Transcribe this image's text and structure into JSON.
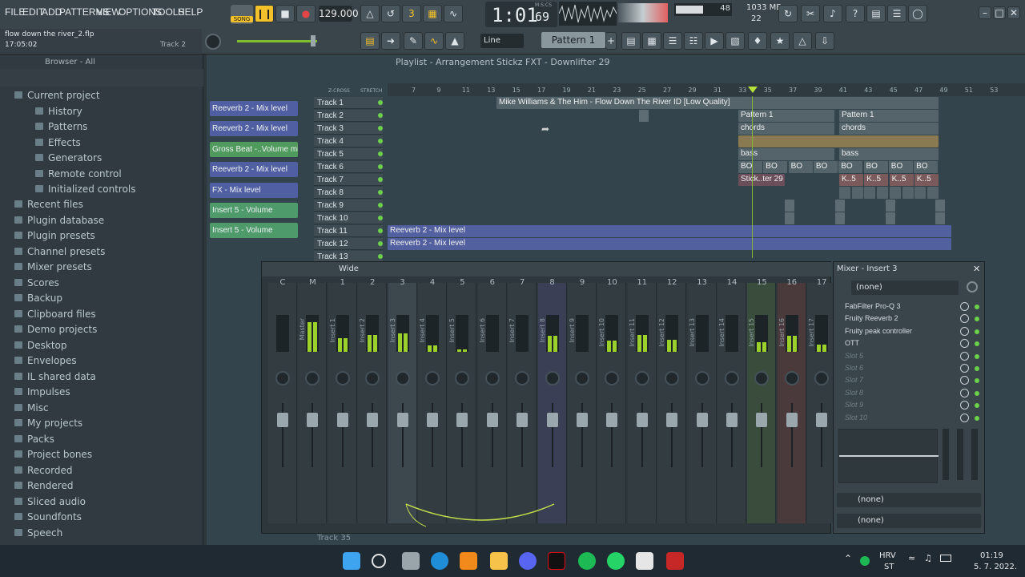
{
  "menu": [
    "FILE",
    "EDIT",
    "ADD",
    "PATTERNS",
    "VIEW",
    "OPTIONS",
    "TOOLS",
    "HELP"
  ],
  "transport": {
    "mode": "SONG",
    "tempo": "129.000",
    "time": "1:01",
    "time_sub": "69",
    "time_label": "M:S:CS",
    "cpu": "48",
    "memory": "1033 MB",
    "voices": "22"
  },
  "song": {
    "filename": "flow down the river_2.flp",
    "timestamp": "17:05:02",
    "track_hint": "Track 2"
  },
  "toolbar2": {
    "snap": "Line",
    "pattern": "Pattern 1"
  },
  "browser": {
    "title": "Browser - All",
    "items": [
      {
        "label": "Current project",
        "level": 0
      },
      {
        "label": "History",
        "level": 1
      },
      {
        "label": "Patterns",
        "level": 1
      },
      {
        "label": "Effects",
        "level": 1
      },
      {
        "label": "Generators",
        "level": 1
      },
      {
        "label": "Remote control",
        "level": 1
      },
      {
        "label": "Initialized controls",
        "level": 1
      },
      {
        "label": "Recent files",
        "level": 0
      },
      {
        "label": "Plugin database",
        "level": 0
      },
      {
        "label": "Plugin presets",
        "level": 0
      },
      {
        "label": "Channel presets",
        "level": 0
      },
      {
        "label": "Mixer presets",
        "level": 0
      },
      {
        "label": "Scores",
        "level": 0
      },
      {
        "label": "Backup",
        "level": 0
      },
      {
        "label": "Clipboard files",
        "level": 0
      },
      {
        "label": "Demo projects",
        "level": 0
      },
      {
        "label": "Desktop",
        "level": 0
      },
      {
        "label": "Envelopes",
        "level": 0
      },
      {
        "label": "IL shared data",
        "level": 0
      },
      {
        "label": "Impulses",
        "level": 0
      },
      {
        "label": "Misc",
        "level": 0
      },
      {
        "label": "My projects",
        "level": 0
      },
      {
        "label": "Packs",
        "level": 0
      },
      {
        "label": "Project bones",
        "level": 0
      },
      {
        "label": "Recorded",
        "level": 0
      },
      {
        "label": "Rendered",
        "level": 0
      },
      {
        "label": "Sliced audio",
        "level": 0
      },
      {
        "label": "Soundfonts",
        "level": 0
      },
      {
        "label": "Speech",
        "level": 0
      }
    ]
  },
  "playlist": {
    "title": "Playlist - Arrangement",
    "breadcrumb": "Stickz FXT - Downlifter 29",
    "labels": [
      "Z-CROSS",
      "STRETCH"
    ],
    "ruler": [
      "7",
      "9",
      "11",
      "13",
      "15",
      "17",
      "19",
      "21",
      "23",
      "25",
      "27",
      "29",
      "31",
      "33",
      "35",
      "37",
      "39",
      "41",
      "43",
      "45",
      "47",
      "49",
      "51",
      "53"
    ],
    "picker": [
      "Reeverb 2 - Mix level",
      "Reeverb 2 - Mix level",
      "Gross Beat -..Volume mix",
      "Reeverb 2 - Mix level",
      "FX - Mix level",
      "Insert 5 - Volume",
      "Insert 5 - Volume"
    ],
    "tracks": [
      "Track 1",
      "Track 2",
      "Track 3",
      "Track 4",
      "Track 5",
      "Track 6",
      "Track 7",
      "Track 8",
      "Track 9",
      "Track 10",
      "Track 11",
      "Track 12",
      "Track 13"
    ],
    "bottom_track": "Track 35",
    "clips": {
      "audio": "Mike Williams & The Him - Flow Down The River ID [Low Quality]",
      "pattern": "Pattern 1",
      "chords": "chords",
      "bass": "bass",
      "bo": "BO",
      "stick": "Stick..ter 29",
      "k5": "K..5",
      "reeverb": "Reeverb 2 - Mix level"
    }
  },
  "mixer": {
    "title": "Mixer - Insert 3",
    "mode": "Wide",
    "strips": [
      "C",
      "M",
      "1",
      "2",
      "3",
      "4",
      "5",
      "6",
      "7",
      "8",
      "9",
      "10",
      "11",
      "12",
      "13",
      "14",
      "15",
      "16",
      "17"
    ],
    "names": [
      "",
      "Master",
      "Insert 1",
      "Insert 2",
      "Insert 3",
      "Insert 4",
      "Insert 5",
      "Insert 6",
      "Insert 7",
      "Insert 8",
      "Insert 9",
      "Insert 10",
      "Insert 11",
      "Insert 12",
      "Insert 13",
      "Insert 14",
      "Insert 15",
      "Insert 16",
      "Insert 17"
    ],
    "input": "(none)",
    "output": "(none)",
    "output2": "(none)",
    "slots": [
      "FabFilter Pro-Q 3",
      "Fruity Reeverb 2",
      "Fruity peak controller",
      "OTT",
      "Slot 5",
      "Slot 6",
      "Slot 7",
      "Slot 8",
      "Slot 9",
      "Slot 10"
    ]
  },
  "taskbar": {
    "lang1": "HRV",
    "lang2": "ST",
    "time": "01:19",
    "date": "5. 7. 2022."
  }
}
